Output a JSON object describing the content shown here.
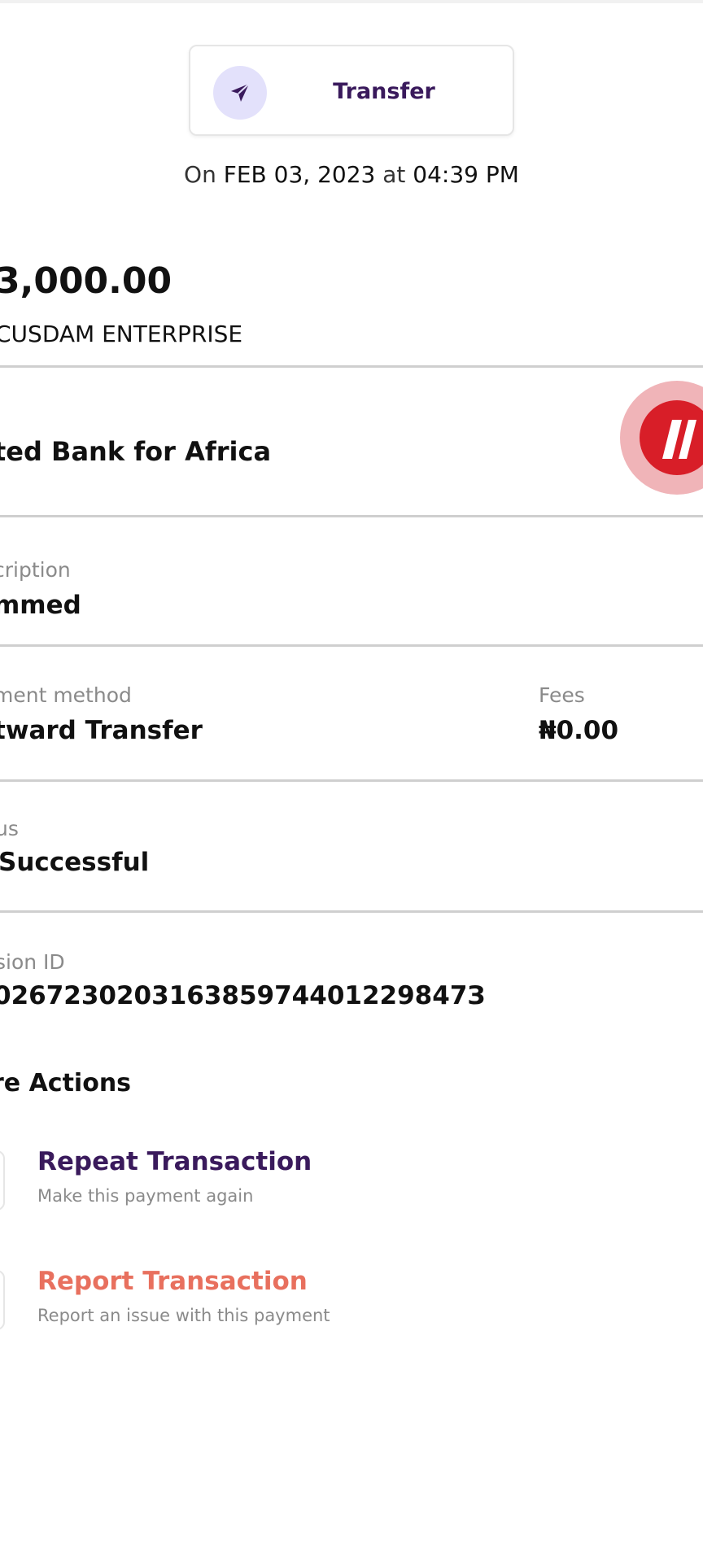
{
  "header": {
    "type_label": "Transfer",
    "type_icon": "send-arrow-icon"
  },
  "datetime": {
    "prefix": "On",
    "date": "FEB 03, 2023",
    "connector": "at",
    "time": "04:39 PM"
  },
  "amount": {
    "value": "3,000.00",
    "recipient": "CUSDAM ENTERPRISE"
  },
  "bank": {
    "name": "ted Bank for Africa",
    "logo_icon": "bank-logo-icon",
    "logo_color": "#d81e28"
  },
  "fields": {
    "description_label": "cription",
    "description_value": "mmed",
    "payment_method_label": "ment method",
    "payment_method_value": "tward Transfer",
    "fees_label": "Fees",
    "fees_value": "₦0.00",
    "status_label": "us",
    "status_value": "Successful",
    "session_label": "sion ID",
    "session_value": "026723020316385974401229847З"
  },
  "more_actions": {
    "title": "re Actions",
    "items": [
      {
        "title": "Repeat Transaction",
        "subtitle": "Make this payment again",
        "color": "#3a1a5c"
      },
      {
        "title": "Report Transaction",
        "subtitle": "Report an issue with this payment",
        "color": "#e8705e"
      }
    ]
  },
  "colors": {
    "brand_purple": "#3a1a5c",
    "accent_lavender": "#e3e1fb",
    "danger_coral": "#e8705e"
  }
}
